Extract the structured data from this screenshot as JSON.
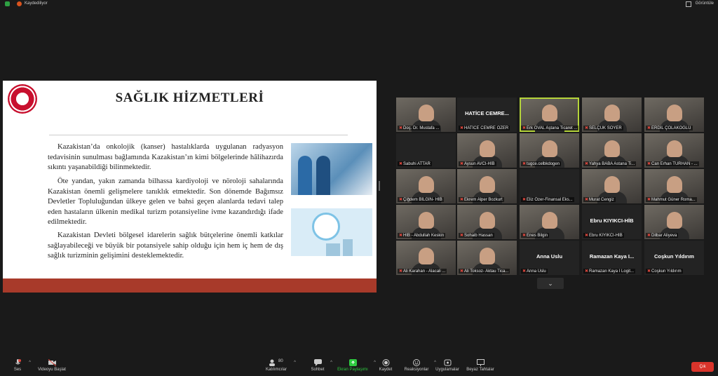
{
  "topbar": {
    "recording": "Kaydediliyor",
    "view": "Görüntüle"
  },
  "slide": {
    "title": "SAĞLIK HİZMETLERİ",
    "paragraphs": [
      "Kazakistan’da onkolojik (kanser) hastalıklarda uygulanan radyasyon tedavisinin sunulması bağlamında Kazakistan’ın kimi bölgelerinde hâlihazırda sıkıntı yaşanabildiği bilinmektedir.",
      "Öte yandan, yakın zamanda bilhassa kardiyoloji ve nöroloji sahalarında Kazakistan önemli gelişmelere tanıklık etmektedir. Son dönemde Bağımsız Devletler Topluluğundan ülkeye gelen ve bahsi geçen alanlarda tedavi talep eden hastaların ülkenin medikal turizm potansiyeline ivme kazandırdığı ifade edilmektedir.",
      "Kazakistan Devleti bölgesel idarelerin sağlık bütçelerine önemli katkılar sağlayabileceği ve büyük bir potansiyele sahip olduğu için hem iç hem de dış sağlık turizminin gelişimini desteklemektedir."
    ]
  },
  "gallery": [
    {
      "name": "Doç. Dr. Mustafa ...",
      "video": true
    },
    {
      "name": "HATİCE CEMRE ÖZER",
      "big": "HATİCE CEMRE..."
    },
    {
      "name": "Erk OVAL Aştana Ticaret ...",
      "video": true,
      "active": true
    },
    {
      "name": "SELÇUK SOYER",
      "video": true
    },
    {
      "name": "ERDİL ÇOLAKOĞLU",
      "video": true
    },
    {
      "name": "Sabuhi ATTAR"
    },
    {
      "name": "Aysun AVCI-HİB",
      "video": true
    },
    {
      "name": "tugce.celbkdogen",
      "video": true
    },
    {
      "name": "Yahya BABA Astana Ti...",
      "video": true
    },
    {
      "name": "Can Erhan TURHAN - ...",
      "video": true
    },
    {
      "name": "Çiğdem BİLGİN- HİB",
      "video": true
    },
    {
      "name": "Ekrem Alper Bozkurt",
      "video": true
    },
    {
      "name": "Eliz Özer-Finansal Eks..."
    },
    {
      "name": "Murat Cengiz",
      "video": true
    },
    {
      "name": "Mahmut Güner Roma...",
      "video": true
    },
    {
      "name": "HİB - Abdullah Keskin",
      "video": true
    },
    {
      "name": "Sohaib Hassan",
      "video": true
    },
    {
      "name": "Enes Bilgin",
      "video": true
    },
    {
      "name": "Ebru KIYIKCI-HİB",
      "big": "Ebru KIYIKCI-HİB"
    },
    {
      "name": "Dilbar Aliyeva",
      "video": true
    },
    {
      "name": "Ali Karahan - Alacali ...",
      "video": true
    },
    {
      "name": "Ali Toksoz- Aktau Tica...",
      "video": true
    },
    {
      "name": "Anna Uslu",
      "big": "Anna Uslu"
    },
    {
      "name": "Ramazan Kaya I Logit...",
      "big": "Ramazan Kaya I..."
    },
    {
      "name": "Coşkun Yıldırım",
      "big": "Coşkun Yıldırım"
    }
  ],
  "toolbar": {
    "audio": "Ses",
    "video": "Videoyu Başlat",
    "participants": "Katılımcılar",
    "participants_count": "80",
    "chat": "Sohbet",
    "share": "Ekran Paylaşımı",
    "record": "Kaydet",
    "reactions": "Reaksiyonlar",
    "apps": "Uygulamalar",
    "whiteboard": "Beyaz Tahtalar",
    "leave": "Çık"
  },
  "colors": {
    "share_green": "#2ecc40",
    "leave_red": "#d9342b",
    "active_border": "#b5d43a"
  }
}
